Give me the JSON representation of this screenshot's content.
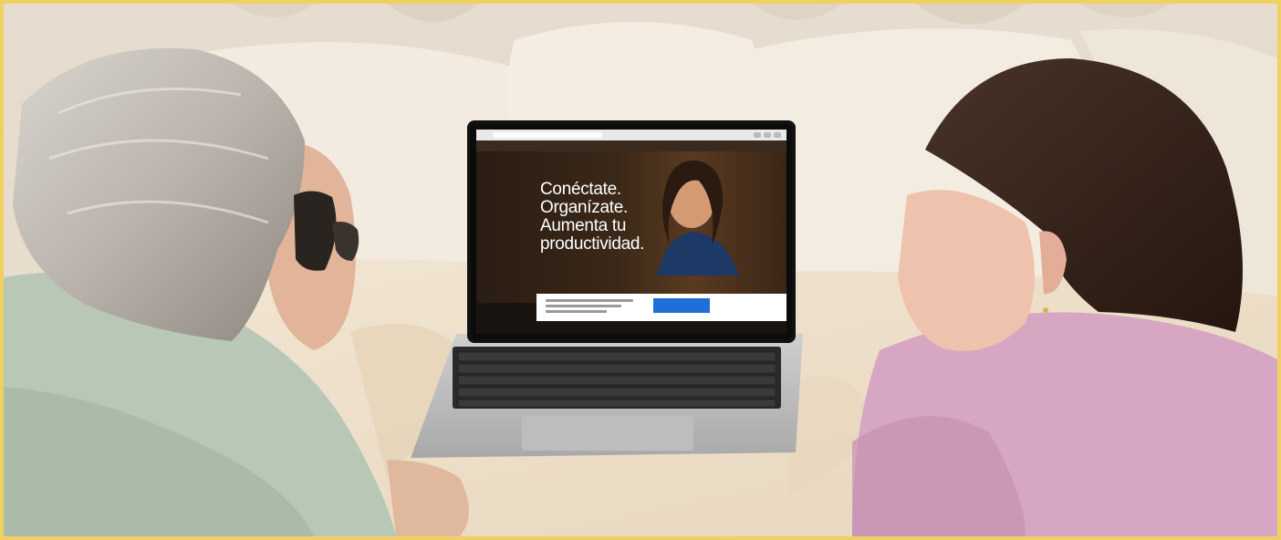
{
  "image": {
    "description_free": true
  },
  "laptop_screen": {
    "headline_lines": [
      "Conéctate.",
      "Organízate.",
      "Aumenta tu",
      "productividad."
    ],
    "cookie_button_label": ""
  },
  "colors": {
    "frame_border": "#f0d060",
    "bedding": "#efe4d4",
    "left_sweater": "#b9c7b6",
    "right_sweater": "#d7a6c2",
    "cookie_button": "#1f6fd6"
  }
}
